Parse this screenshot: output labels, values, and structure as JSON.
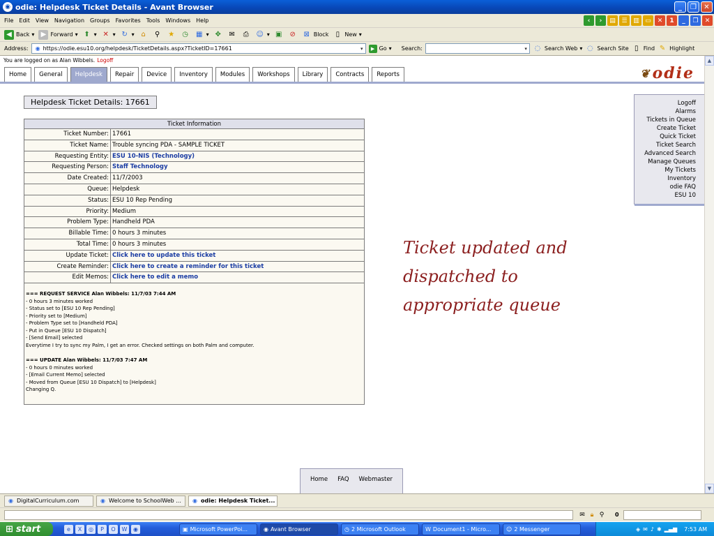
{
  "window": {
    "title": "odie: Helpdesk Ticket Details - Avant Browser"
  },
  "menu": [
    "File",
    "Edit",
    "View",
    "Navigation",
    "Groups",
    "Favorites",
    "Tools",
    "Windows",
    "Help"
  ],
  "toolbar": {
    "back": "Back",
    "forward": "Forward",
    "block": "Block",
    "new": "New"
  },
  "address": {
    "label": "Address:",
    "url": "https://odie.esu10.org/helpdesk/TicketDetails.aspx?TicketID=17661",
    "go": "Go",
    "search_label": "Search:",
    "search_web": "Search Web",
    "search_site": "Search Site",
    "find": "Find",
    "highlight": "Highlight"
  },
  "page": {
    "logon_text": "You are logged on as Alan Wibbels.",
    "logoff": "Logoff",
    "tabs": [
      "Home",
      "General",
      "Helpdesk",
      "Repair",
      "Device",
      "Inventory",
      "Modules",
      "Workshops",
      "Library",
      "Contracts",
      "Reports"
    ],
    "active_tab": "Helpdesk",
    "logo": "odie",
    "title": "Helpdesk Ticket Details: 17661"
  },
  "ticket": {
    "header": "Ticket Information",
    "rows": [
      {
        "label": "Ticket Number:",
        "value": "17661",
        "link": false
      },
      {
        "label": "Ticket Name:",
        "value": "Trouble syncing PDA - SAMPLE TICKET",
        "link": false
      },
      {
        "label": "Requesting Entity:",
        "value": "ESU 10-NIS (Technology)",
        "link": true
      },
      {
        "label": "Requesting Person:",
        "value": "Staff Technology",
        "link": true
      },
      {
        "label": "Date Created:",
        "value": "11/7/2003",
        "link": false
      },
      {
        "label": "Queue:",
        "value": "Helpdesk",
        "link": false
      },
      {
        "label": "Status:",
        "value": "ESU 10 Rep Pending",
        "link": false
      },
      {
        "label": "Priority:",
        "value": "Medium",
        "link": false
      },
      {
        "label": "Problem Type:",
        "value": "Handheld PDA",
        "link": false
      },
      {
        "label": "Billable Time:",
        "value": "0 hours 3 minutes",
        "link": false
      },
      {
        "label": "Total Time:",
        "value": "0 hours 3 minutes",
        "link": false
      },
      {
        "label": "Update Ticket:",
        "value": "Click here to update this ticket",
        "link": true
      },
      {
        "label": "Create Reminder:",
        "value": "Click here to create a reminder for this ticket",
        "link": true
      },
      {
        "label": "Edit Memos:",
        "value": "Click here to edit a memo",
        "link": true
      }
    ],
    "memo1_head": "=== REQUEST SERVICE    Alan Wibbels:    11/7/03 7:44 AM",
    "memo1_lines": [
      "- 0 hours 3 minutes worked",
      "- Status set to [ESU 10 Rep Pending]",
      "- Priority set to [Medium]",
      "- Problem Type set to [Handheld PDA]",
      "- Put in Queue [ESU 10 Dispatch]",
      "- [Send Email] selected",
      "Everytime I try to sync my Palm, I get an error. Checked settings on both Palm and computer."
    ],
    "memo2_head": "=== UPDATE    Alan Wibbels:    11/7/03 7:47 AM",
    "memo2_lines": [
      "- 0 hours 0 minutes worked",
      "- [Email Current Memo] selected",
      "- Moved from Queue [ESU 10 Dispatch] to [Helpdesk]",
      "Changing Q."
    ]
  },
  "right_menu": [
    "Logoff",
    "Alarms",
    "Tickets in Queue",
    "Create Ticket",
    "Quick Ticket",
    "Ticket Search",
    "Advanced Search",
    "Manage Queues",
    "My Tickets",
    "Inventory",
    "odie FAQ",
    "ESU 10"
  ],
  "note": [
    "Ticket updated and",
    "dispatched to",
    "appropriate queue"
  ],
  "footer_links": [
    "Home",
    "FAQ",
    "Webmaster"
  ],
  "browser_tabs": [
    "DigitalCurriculum.com",
    "Welcome to SchoolWeb ...",
    "odie: Helpdesk Ticket..."
  ],
  "status": {
    "count": "0"
  },
  "taskbar": {
    "start": "start",
    "tasks": [
      "Microsoft PowerPoi...",
      "Avant Browser",
      "2 Microsoft Outlook",
      "Document1 - Micro...",
      "2 Messenger"
    ],
    "clock": "7:53 AM"
  },
  "colors": {
    "tab_active": "#9fa9ce",
    "link": "#1a3ca3",
    "note": "#8b1e1e",
    "logoff": "#cc0000"
  }
}
